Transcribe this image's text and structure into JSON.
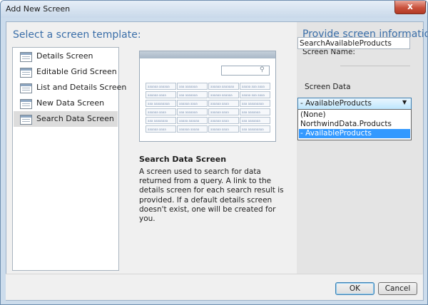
{
  "window": {
    "title": "Add New Screen",
    "close_label": "x"
  },
  "left": {
    "heading": "Select a screen template:",
    "templates": [
      {
        "label": "Details Screen",
        "icon": "details-screen-icon"
      },
      {
        "label": "Editable Grid Screen",
        "icon": "grid-screen-icon"
      },
      {
        "label": "List and Details Screen",
        "icon": "list-details-screen-icon"
      },
      {
        "label": "New Data Screen",
        "icon": "new-data-screen-icon"
      },
      {
        "label": "Search Data Screen",
        "icon": "search-data-screen-icon",
        "selected": true
      }
    ]
  },
  "preview": {
    "rows": [
      [
        "aaaaaa aaaaaa",
        "aaa aaaaaaa",
        "aaaaaa aaaaaaa",
        "aaaaa aaa aaaa"
      ],
      [
        "aaaaaa aaaa",
        "aaa aaaaaaa",
        "aaaaaa aaaaaa",
        "aaaaa aaa aaaa"
      ],
      [
        "aaa aaaaaaaaa",
        "aaaaaa aaaa",
        "aaaaaa aaaa",
        "aaa aaaaaaaaa"
      ],
      [
        "aaaaaa aaaa",
        "aaa aaaaaaa",
        "aaaaaa aaaa",
        "aaa aaaaaaa"
      ],
      [
        "aaa aaaaaaaa",
        "aaaaa aaaaaa",
        "aaaaaa aaaa",
        "aaa aaaaaaa"
      ],
      [
        "aaaaaa aaaa",
        "aaaaaa aaaaa",
        "aaaaaa aaaa",
        "aaa aaaaaaaaa"
      ]
    ],
    "title": "Search Data Screen",
    "description": "A screen used to search for data returned from a query.  A link to the details screen for each search result is provided.  If a default details screen doesn't exist, one will be created for you."
  },
  "right": {
    "heading": "Provide screen information:",
    "screen_name_label": "Screen Name:",
    "screen_name_value": "SearchAvailableProducts",
    "screen_data_label": "Screen Data",
    "screen_data_selected": "- AvailableProducts",
    "options": [
      "(None)",
      "NorthwindData.Products",
      "- AvailableProducts"
    ],
    "selected_option_index": 2
  },
  "footer": {
    "ok_label": "OK",
    "cancel_label": "Cancel"
  },
  "colors": {
    "heading": "#3a6ea8",
    "selection": "#3399ff",
    "titlebar": "#c9d9ea",
    "close": "#c9513c"
  }
}
